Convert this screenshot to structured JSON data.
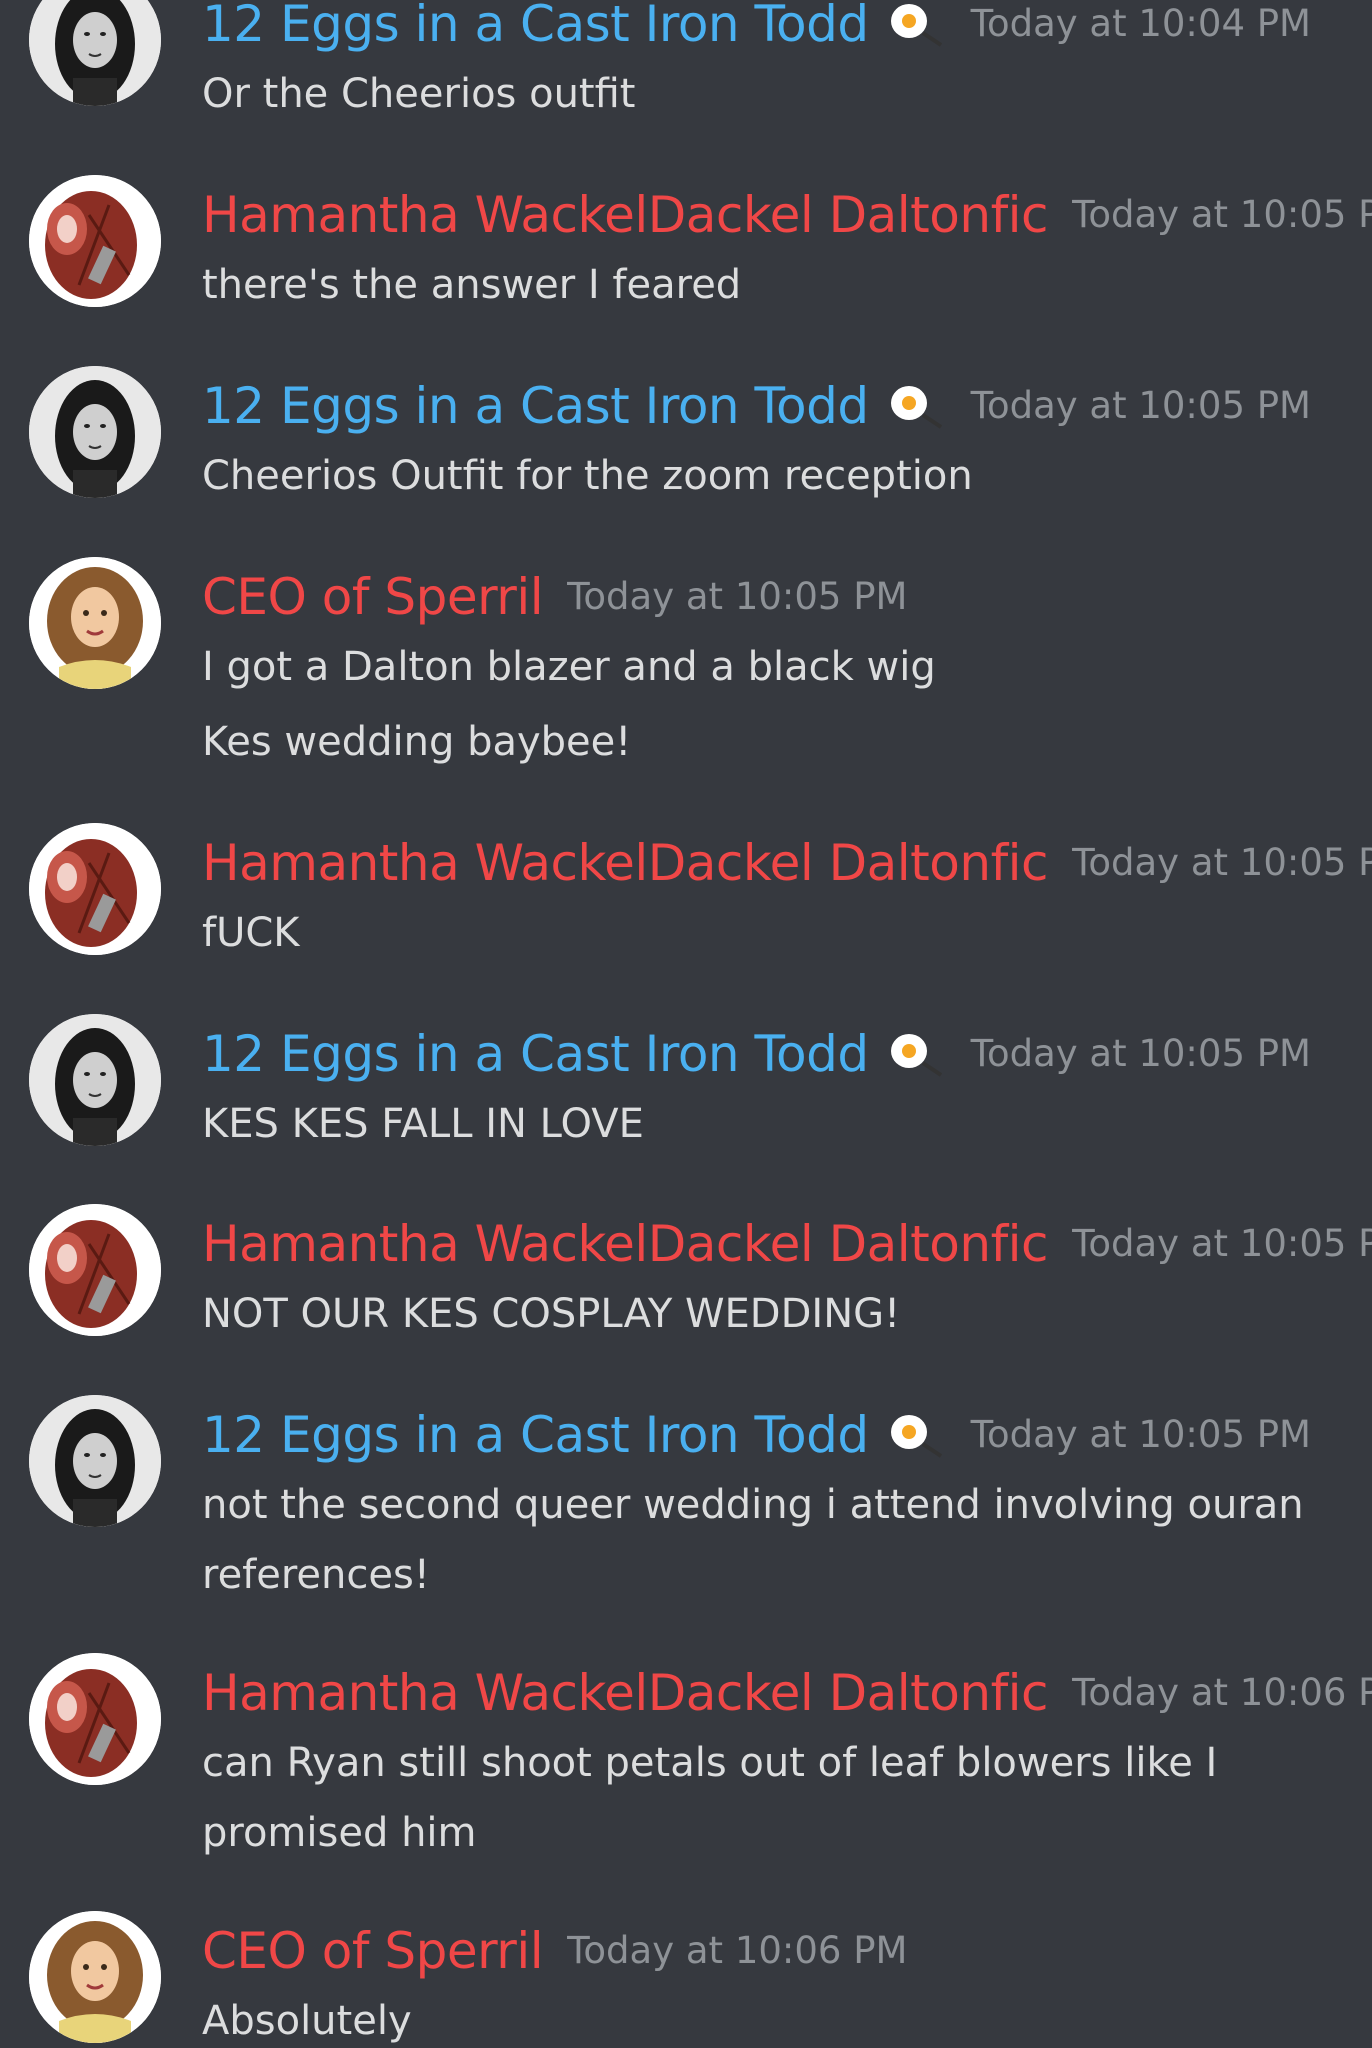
{
  "messages": [
    {
      "author": "12 Eggs in a Cast Iron Todd",
      "author_color": "#4ab0f0",
      "badge_icon": "fried-egg-pan-icon",
      "timestamp": "Today at 10:04 PM",
      "lines": [
        "Or the Cheerios outfit"
      ]
    },
    {
      "author": "Hamantha WackelDackel Daltonfic",
      "author_color": "#f04747",
      "timestamp": "Today at 10:05 P",
      "lines": [
        "there's the answer I feared"
      ]
    },
    {
      "author": "12 Eggs in a Cast Iron Todd",
      "author_color": "#4ab0f0",
      "badge_icon": "fried-egg-pan-icon",
      "timestamp": "Today at 10:05 PM",
      "lines": [
        "Cheerios Outfit for the zoom reception"
      ]
    },
    {
      "author": "CEO of Sperril",
      "author_color": "#f04747",
      "timestamp": "Today at 10:05 PM",
      "lines": [
        "I got a Dalton blazer and a black wig",
        "Kes wedding baybee!"
      ]
    },
    {
      "author": "Hamantha WackelDackel Daltonfic",
      "author_color": "#f04747",
      "timestamp": "Today at 10:05 P",
      "lines": [
        "fUCK"
      ]
    },
    {
      "author": "12 Eggs in a Cast Iron Todd",
      "author_color": "#4ab0f0",
      "badge_icon": "fried-egg-pan-icon",
      "timestamp": "Today at 10:05 PM",
      "lines": [
        "KES KES FALL IN LOVE"
      ]
    },
    {
      "author": "Hamantha WackelDackel Daltonfic",
      "author_color": "#f04747",
      "timestamp": "Today at 10:05 P",
      "lines": [
        "NOT OUR KES COSPLAY WEDDING!"
      ]
    },
    {
      "author": "12 Eggs in a Cast Iron Todd",
      "author_color": "#4ab0f0",
      "badge_icon": "fried-egg-pan-icon",
      "timestamp": "Today at 10:05 PM",
      "lines": [
        "not the second queer wedding i attend involving ouran",
        "references!"
      ]
    },
    {
      "author": "Hamantha WackelDackel Daltonfic",
      "author_color": "#f04747",
      "timestamp": "Today at 10:06 P",
      "lines": [
        "can Ryan still shoot petals out of leaf blowers like I",
        "promised him"
      ]
    },
    {
      "author": "CEO of Sperril",
      "author_color": "#f04747",
      "timestamp": "Today at 10:06 PM",
      "lines": [
        "Absolutely"
      ]
    }
  ]
}
